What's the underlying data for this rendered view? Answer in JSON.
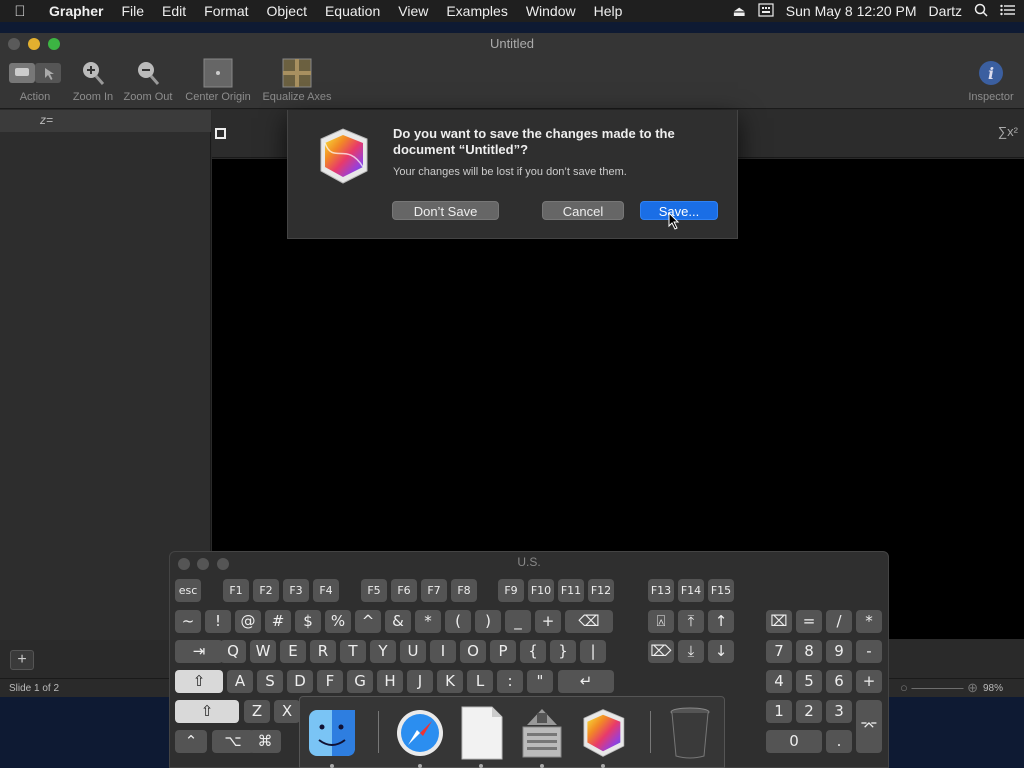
{
  "menubar": {
    "app_name": "Grapher",
    "items": [
      "File",
      "Edit",
      "Format",
      "Object",
      "Equation",
      "View",
      "Examples",
      "Window",
      "Help"
    ],
    "datetime": "Sun May 8  12:20 PM",
    "user": "Dartz"
  },
  "window": {
    "title": "Untitled",
    "toolbar": {
      "action": "Action",
      "zoom_in": "Zoom In",
      "zoom_out": "Zoom Out",
      "center_origin": "Center Origin",
      "equalize_axes": "Equalize Axes",
      "inspector": "Inspector"
    },
    "equation_label": "z=",
    "status": {
      "slide": "Slide 1 of 2",
      "zoom": "98%"
    }
  },
  "dialog": {
    "title": "Do you want to save the changes made to the document “Untitled”?",
    "message": "Your changes will be lost if you don’t save them.",
    "dont_save": "Don’t Save",
    "cancel": "Cancel",
    "save": "Save..."
  },
  "keyboard": {
    "title": "U.S.",
    "fn_keys": [
      "esc",
      "F1",
      "F2",
      "F3",
      "F4",
      "F5",
      "F6",
      "F7",
      "F8",
      "F9",
      "F10",
      "F11",
      "F12",
      "F13",
      "F14",
      "F15"
    ],
    "row1": [
      "~",
      "!",
      "@",
      "#",
      "$",
      "%",
      "^",
      "&",
      "*",
      "(",
      ")",
      "_",
      "+"
    ],
    "row2": [
      "Q",
      "W",
      "E",
      "R",
      "T",
      "Y",
      "U",
      "I",
      "O",
      "P",
      "{",
      "}",
      "|"
    ],
    "row3": [
      "A",
      "S",
      "D",
      "F",
      "G",
      "H",
      "J",
      "K",
      "L",
      ":",
      "\""
    ],
    "row4": [
      "Z",
      "X"
    ],
    "nav_keys": [
      "⍓",
      "⤒",
      "↑",
      "⌦",
      "⤓",
      "↓"
    ],
    "numpad": [
      "⌧",
      "=",
      "/",
      "*",
      "7",
      "8",
      "9",
      "-",
      "4",
      "5",
      "6",
      "+",
      "1",
      "2",
      "3",
      "0",
      "."
    ],
    "special": {
      "tab": "⇥",
      "delete": "⌫",
      "return": "↵",
      "shift": "⇧",
      "control": "⌃",
      "option": "⌥",
      "command": "⌘",
      "enter": "⌤"
    }
  },
  "dock": {
    "apps": [
      "finder-icon",
      "safari-icon",
      "textedit-icon",
      "bootcamp-icon",
      "grapher-icon",
      "trash-icon"
    ]
  }
}
